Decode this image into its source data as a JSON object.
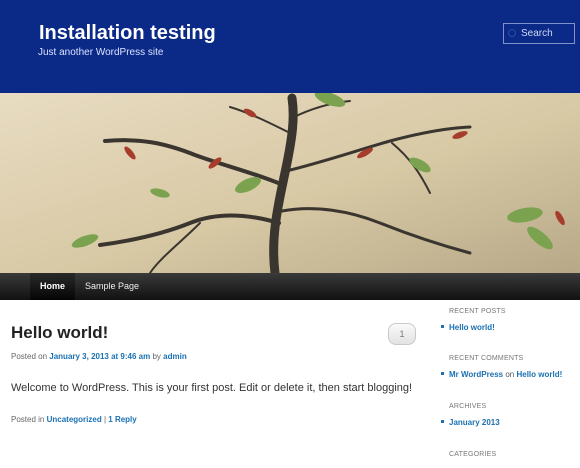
{
  "header": {
    "site_title": "Installation testing",
    "tagline": "Just another WordPress site",
    "search_placeholder": "Search"
  },
  "nav": {
    "items": [
      {
        "label": "Home",
        "active": true
      },
      {
        "label": "Sample Page",
        "active": false
      }
    ]
  },
  "post": {
    "title": "Hello world!",
    "comment_count": "1",
    "meta_posted_on": "Posted on",
    "date": "January 3, 2013 at 9:46 am",
    "meta_by": "by",
    "author": "admin",
    "content": "Welcome to WordPress. This is your first post. Edit or delete it, then start blogging!",
    "footer_posted_in": "Posted in",
    "category": "Uncategorized",
    "separator": "|",
    "reply": "1 Reply"
  },
  "sidebar": {
    "recent_posts_title": "RECENT POSTS",
    "recent_post": "Hello world!",
    "recent_comments_title": "RECENT COMMENTS",
    "comment_author": "Mr WordPress",
    "comment_on": "on",
    "comment_post": "Hello world!",
    "archives_title": "ARCHIVES",
    "archive_item": "January 2013",
    "categories_title": "CATEGORIES"
  },
  "colors": {
    "header_bg": "#0b2a88",
    "link": "#1a71b3",
    "nav_bg": "#222222"
  }
}
